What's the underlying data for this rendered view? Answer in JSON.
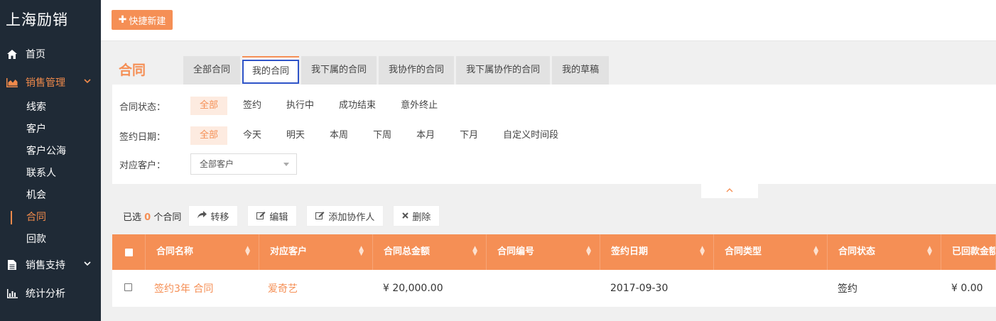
{
  "app": {
    "brand": "上海励销"
  },
  "sidebar": {
    "items": [
      {
        "label": "首页",
        "icon": "home-icon"
      },
      {
        "label": "销售管理",
        "icon": "area-chart-icon",
        "active": true
      },
      {
        "label": "销售支持",
        "icon": "document-icon"
      },
      {
        "label": "统计分析",
        "icon": "bar-chart-icon"
      }
    ],
    "sub_items": [
      "线索",
      "客户",
      "客户公海",
      "联系人",
      "机会",
      "合同",
      "回款"
    ],
    "active_sub": "合同"
  },
  "topbar": {
    "quick_new_label": "快捷新建"
  },
  "page": {
    "title": "合同",
    "tabs": [
      "全部合同",
      "我的合同",
      "我下属的合同",
      "我协作的合同",
      "我下属协作的合同",
      "我的草稿"
    ],
    "active_tab": "我的合同"
  },
  "filters": {
    "status_label": "合同状态：",
    "status_options": [
      "全部",
      "签约",
      "执行中",
      "成功结束",
      "意外终止"
    ],
    "date_label": "签约日期：",
    "date_options": [
      "全部",
      "今天",
      "明天",
      "本周",
      "下周",
      "本月",
      "下月",
      "自定义时间段"
    ],
    "customer_label": "对应客户：",
    "customer_value": "全部客户"
  },
  "actions": {
    "selected_prefix": "已选",
    "selected_count": "0",
    "selected_suffix": "个合同",
    "transfer": "转移",
    "edit": "编辑",
    "add_collaborator": "添加协作人",
    "delete": "删除"
  },
  "table": {
    "columns": [
      "合同名称",
      "对应客户",
      "合同总金额",
      "合同编号",
      "签约日期",
      "合同类型",
      "合同状态",
      "已回款金额"
    ],
    "rows": [
      [
        "签约3年 合同",
        "爱奇艺",
        "¥ 20,000.00",
        "",
        "2017-09-30",
        "",
        "签约",
        "¥ 0.00"
      ]
    ]
  },
  "colors": {
    "accent": "#f58f55",
    "sidebar_bg": "#1f2a36",
    "tab_focus": "#2f54c8"
  }
}
